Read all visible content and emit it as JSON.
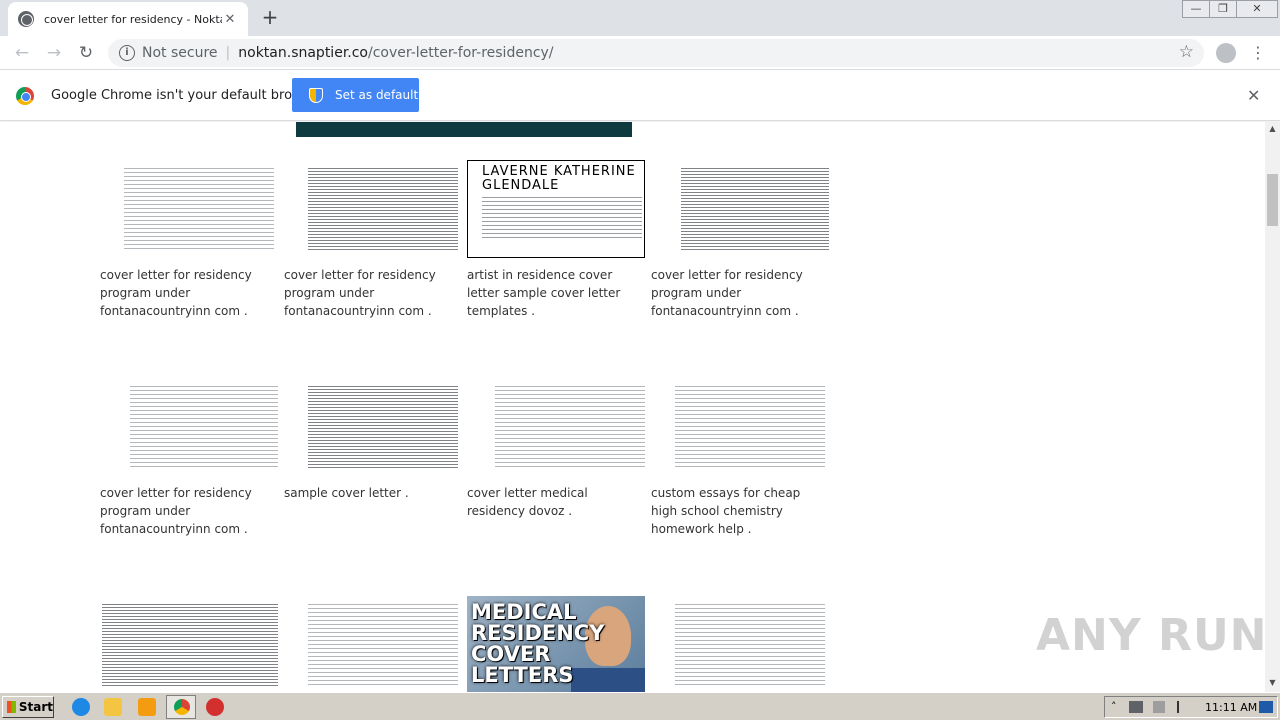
{
  "browser": {
    "tab_title": "cover letter for residency - Noktan.s",
    "tab_close": "✕",
    "new_tab": "+",
    "window_controls": [
      "—",
      "❐",
      "✕"
    ],
    "nav": {
      "back": "←",
      "forward": "→",
      "reload": "↻"
    },
    "security_label": "Not secure",
    "url_host": "noktan.snaptier.co",
    "url_path": "/cover-letter-for-residency/",
    "bookmark": "☆",
    "menu": "⋮"
  },
  "infobar": {
    "message": "Google Chrome isn't your default browser",
    "button": "Set as default",
    "close": "✕"
  },
  "gallery": [
    {
      "caption": "cover letter for residency program under fontanacountryinn com ."
    },
    {
      "caption": "cover letter for residency program under fontanacountryinn com ."
    },
    {
      "caption": "artist in residence cover letter sample cover letter templates .",
      "thumb_text": "LAVERNE KATHERINE GLENDALE"
    },
    {
      "caption": "cover letter for residency program under fontanacountryinn com ."
    },
    {
      "caption": "cover letter for residency program under fontanacountryinn com ."
    },
    {
      "caption": "sample cover letter ."
    },
    {
      "caption": "cover letter medical residency dovoz ."
    },
    {
      "caption": "custom essays for cheap high school chemistry homework help ."
    },
    {
      "caption": ""
    },
    {
      "caption": ""
    },
    {
      "caption": "",
      "thumb_text": "MEDICAL RESIDENCY COVER LETTERS"
    },
    {
      "caption": ""
    }
  ],
  "watermark": "ANY RUN",
  "taskbar": {
    "start_label": "Start",
    "clock": "11:11 AM"
  }
}
